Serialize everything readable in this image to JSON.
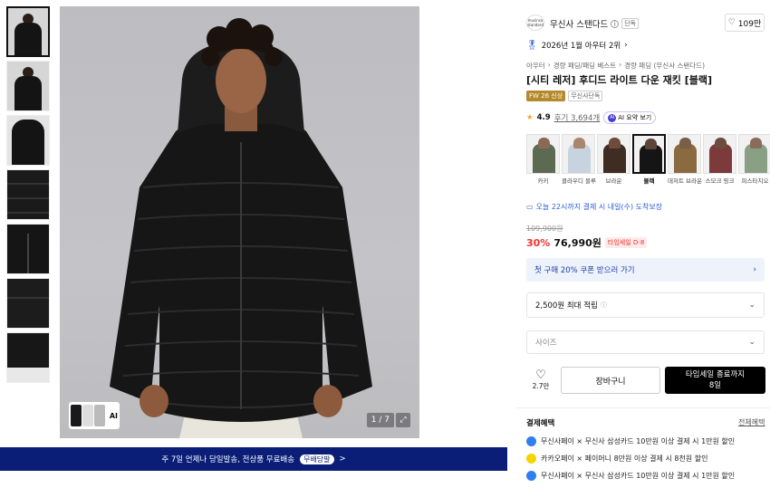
{
  "gallery": {
    "ai_label": "AI",
    "counter": "1 / 7",
    "expand_icon": "expand-icon"
  },
  "promo_banner": {
    "text": "주 7일 언제나 당일발송, 전상품 무료배송",
    "tag": "무배당발",
    "arrow": ">"
  },
  "brand": {
    "logo_text": "musinsa standard",
    "name": "무신사 스탠다드",
    "badge": "단독",
    "likes": "109만"
  },
  "ranking": "2026년 1월 아우터 2위",
  "breadcrumb": [
    "아우터",
    "경량 패딩/패딩 베스트",
    "경량 패딩 (무신사 스탠다드)"
  ],
  "product": {
    "title": "[시티 레저] 후디드 라이트 다운 재킷 [블랙]",
    "tag_season": "FW 26 신상",
    "tag_exclusive": "무신사단독",
    "rating": "4.9",
    "reviews": "후기 3,694개",
    "ai_summary": "AI 요약 보기"
  },
  "colors": [
    {
      "label": "카키",
      "body": "#5d6a52",
      "hood": "#8a6a55"
    },
    {
      "label": "클라우디 블루",
      "body": "#c7d4df",
      "hood": "#a8866d"
    },
    {
      "label": "브라운",
      "body": "#3f2c22",
      "hood": "#6d4c3c"
    },
    {
      "label": "블랙",
      "body": "#151515",
      "hood": "#5b4538",
      "selected": true
    },
    {
      "label": "데저트 브라운",
      "body": "#8a6a3f",
      "hood": "#7a5e48"
    },
    {
      "label": "스모크 핑크",
      "body": "#7d3a3a",
      "hood": "#6b4c3e"
    },
    {
      "label": "피스타치오",
      "body": "#8aa085",
      "hood": "#8a6c5a"
    }
  ],
  "delivery": "오늘 22시까지 결제 시 내일(수) 도착보장",
  "price": {
    "original": "109,900원",
    "discount": "30%",
    "final": "76,990원",
    "timesale": "타임세일 D-8"
  },
  "coupon": "첫 구매 20% 쿠폰 받으러 가기",
  "points": {
    "text": "2,500원 최대 적립",
    "info_icon": "info-icon"
  },
  "size_select": {
    "placeholder": "사이즈"
  },
  "actions": {
    "wish_count": "2.7만",
    "cart": "장바구니",
    "buy_line1": "타임세일 종료까지",
    "buy_line2": "8일"
  },
  "benefits": {
    "title": "결제혜택",
    "view_all": "전체혜택",
    "items": [
      {
        "text": "무신사페이 × 무신사 삼성카드 10만원 이상 결제 시 1만원 할인",
        "color": "#2f7ff0"
      },
      {
        "text": "카카오페이 × 페이머니 8만원 이상 결제 시 8천원 할인",
        "color": "#f5d400"
      },
      {
        "text": "무신사페이 × 무신사 삼성카드 10만원 이상 결제 시 1만원 할인",
        "color": "#2f7ff0"
      }
    ]
  },
  "accent": {
    "red": "#f0332e",
    "navy": "#0a1e78",
    "blue": "#1a3fa8"
  }
}
